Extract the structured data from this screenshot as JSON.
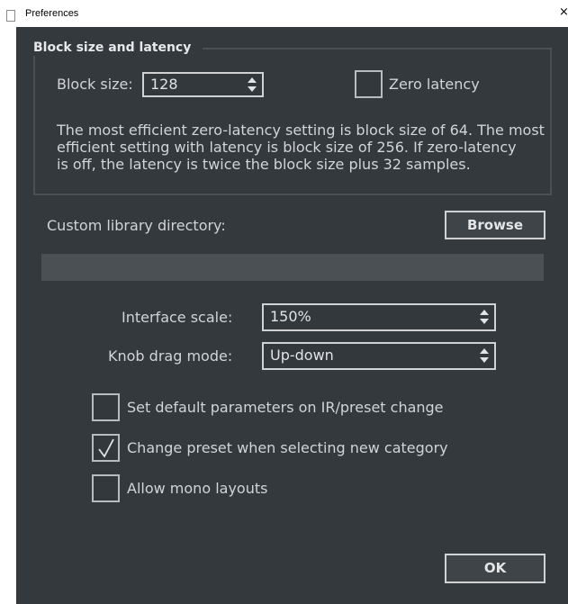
{
  "window": {
    "title": "Preferences",
    "close_glyph": "×"
  },
  "block_group": {
    "title": "Block size and latency",
    "block_size_label": "Block size:",
    "block_size_value": "128",
    "zero_latency_label": "Zero latency",
    "zero_latency_checked": false,
    "info_lines": [
      "The most efficient zero-latency setting is block size of 64. The most",
      "efficient setting with latency is block size of 256. If zero-latency",
      "is off, the latency is twice the block size plus 32 samples."
    ]
  },
  "library": {
    "label": "Custom library directory:",
    "browse_label": "Browse",
    "path_value": ""
  },
  "interface_scale": {
    "label": "Interface scale:",
    "value": "150%"
  },
  "knob_drag_mode": {
    "label": "Knob drag mode:",
    "value": "Up-down"
  },
  "options": [
    {
      "label": "Set default parameters on IR/preset change",
      "checked": false
    },
    {
      "label": "Change preset when selecting new category",
      "checked": true
    },
    {
      "label": "Allow mono layouts",
      "checked": false
    }
  ],
  "footer": {
    "ok_label": "OK"
  },
  "icons": {
    "spinner": "up-down-arrows-icon",
    "check": "checkmark-icon",
    "document": "document-icon"
  },
  "colors": {
    "panel_bg": "#34393d",
    "text": "#d2d4d6",
    "border": "#d0d2d4",
    "field_bg": "#4a5054"
  }
}
